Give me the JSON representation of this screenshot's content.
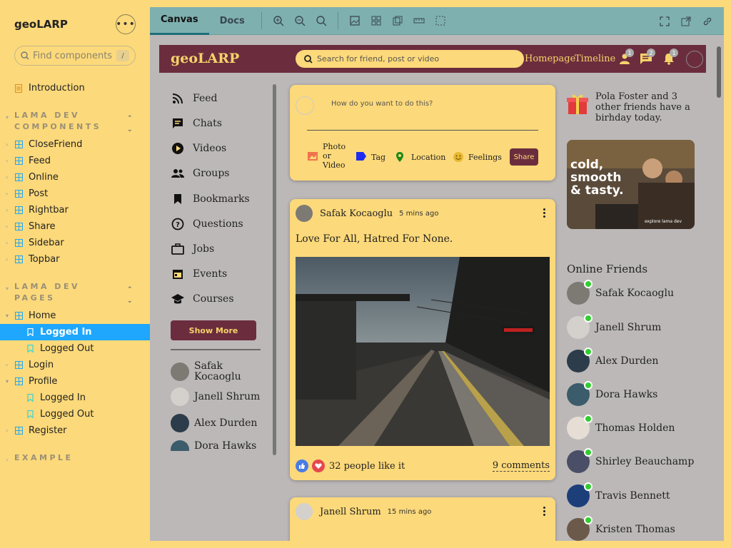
{
  "sidebar": {
    "brand": "geoLARP",
    "search_placeholder": "Find components",
    "search_shortcut": "/",
    "intro": "Introduction",
    "groups": [
      {
        "title": "LAMA DEV COMPONENTS",
        "items": [
          "CloseFriend",
          "Feed",
          "Online",
          "Post",
          "Rightbar",
          "Share",
          "Sidebar",
          "Topbar"
        ]
      },
      {
        "title": "LAMA DEV PAGES",
        "items": [
          "Home",
          "Logged In",
          "Logged Out",
          "Login",
          "Profile",
          "Logged In",
          "Logged Out",
          "Register"
        ]
      },
      {
        "title": "EXAMPLE"
      }
    ],
    "selected": "Logged In"
  },
  "toolbar": {
    "tabs": [
      "Canvas",
      "Docs"
    ],
    "active_tab": "Canvas"
  },
  "app": {
    "logo": "geoLARP",
    "search_placeholder": "Search for friend, post or video",
    "links": [
      "Homepage",
      "Timeline"
    ],
    "badges": [
      "1",
      "2",
      "1"
    ],
    "left_nav": [
      "Feed",
      "Chats",
      "Videos",
      "Groups",
      "Bookmarks",
      "Questions",
      "Jobs",
      "Events",
      "Courses"
    ],
    "show_more": "Show More",
    "left_friends": [
      "Safak Kocaoglu",
      "Janell Shrum",
      "Alex Durden",
      "Dora Hawks"
    ],
    "share": {
      "placeholder": "How do you want to do this?",
      "options": [
        "Photo or Video",
        "Tag",
        "Location",
        "Feelings"
      ],
      "button": "Share"
    },
    "post1": {
      "author": "Safak Kocaoglu",
      "time": "5 mins ago",
      "text": "Love For All, Hatred For None.",
      "likes": "32 people like it",
      "comments": "9 comments"
    },
    "post2": {
      "author": "Janell Shrum",
      "time": "15 mins ago"
    },
    "birthday": {
      "text": "Pola Foster and 3 other friends have a birhday today."
    },
    "ad": {
      "line1": "cold,",
      "line2": "smooth",
      "line3": "& tasty.",
      "small": "explore lama dev"
    },
    "online_title": "Online Friends",
    "online": [
      "Safak Kocaoglu",
      "Janell Shrum",
      "Alex Durden",
      "Dora Hawks",
      "Thomas Holden",
      "Shirley Beauchamp",
      "Travis Bennett",
      "Kristen Thomas"
    ]
  }
}
